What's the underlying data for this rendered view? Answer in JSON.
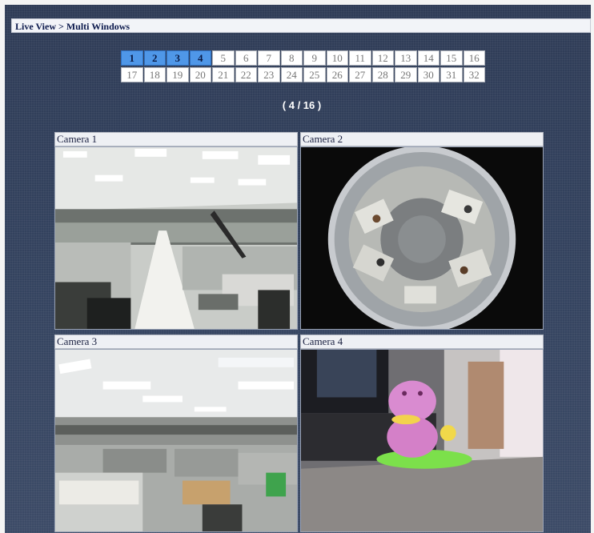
{
  "breadcrumb": "Live View > Multi Windows",
  "pager": {
    "pages": [
      "1",
      "2",
      "3",
      "4",
      "5",
      "6",
      "7",
      "8",
      "9",
      "10",
      "11",
      "12",
      "13",
      "14",
      "15",
      "16",
      "17",
      "18",
      "19",
      "20",
      "21",
      "22",
      "23",
      "24",
      "25",
      "26",
      "27",
      "28",
      "29",
      "30",
      "31",
      "32"
    ],
    "active": [
      "1",
      "2",
      "3",
      "4"
    ]
  },
  "page_count": "( 4 / 16 )",
  "cameras": [
    {
      "title": "Camera 1"
    },
    {
      "title": "Camera 2"
    },
    {
      "title": "Camera 3"
    },
    {
      "title": "Camera 4"
    }
  ]
}
